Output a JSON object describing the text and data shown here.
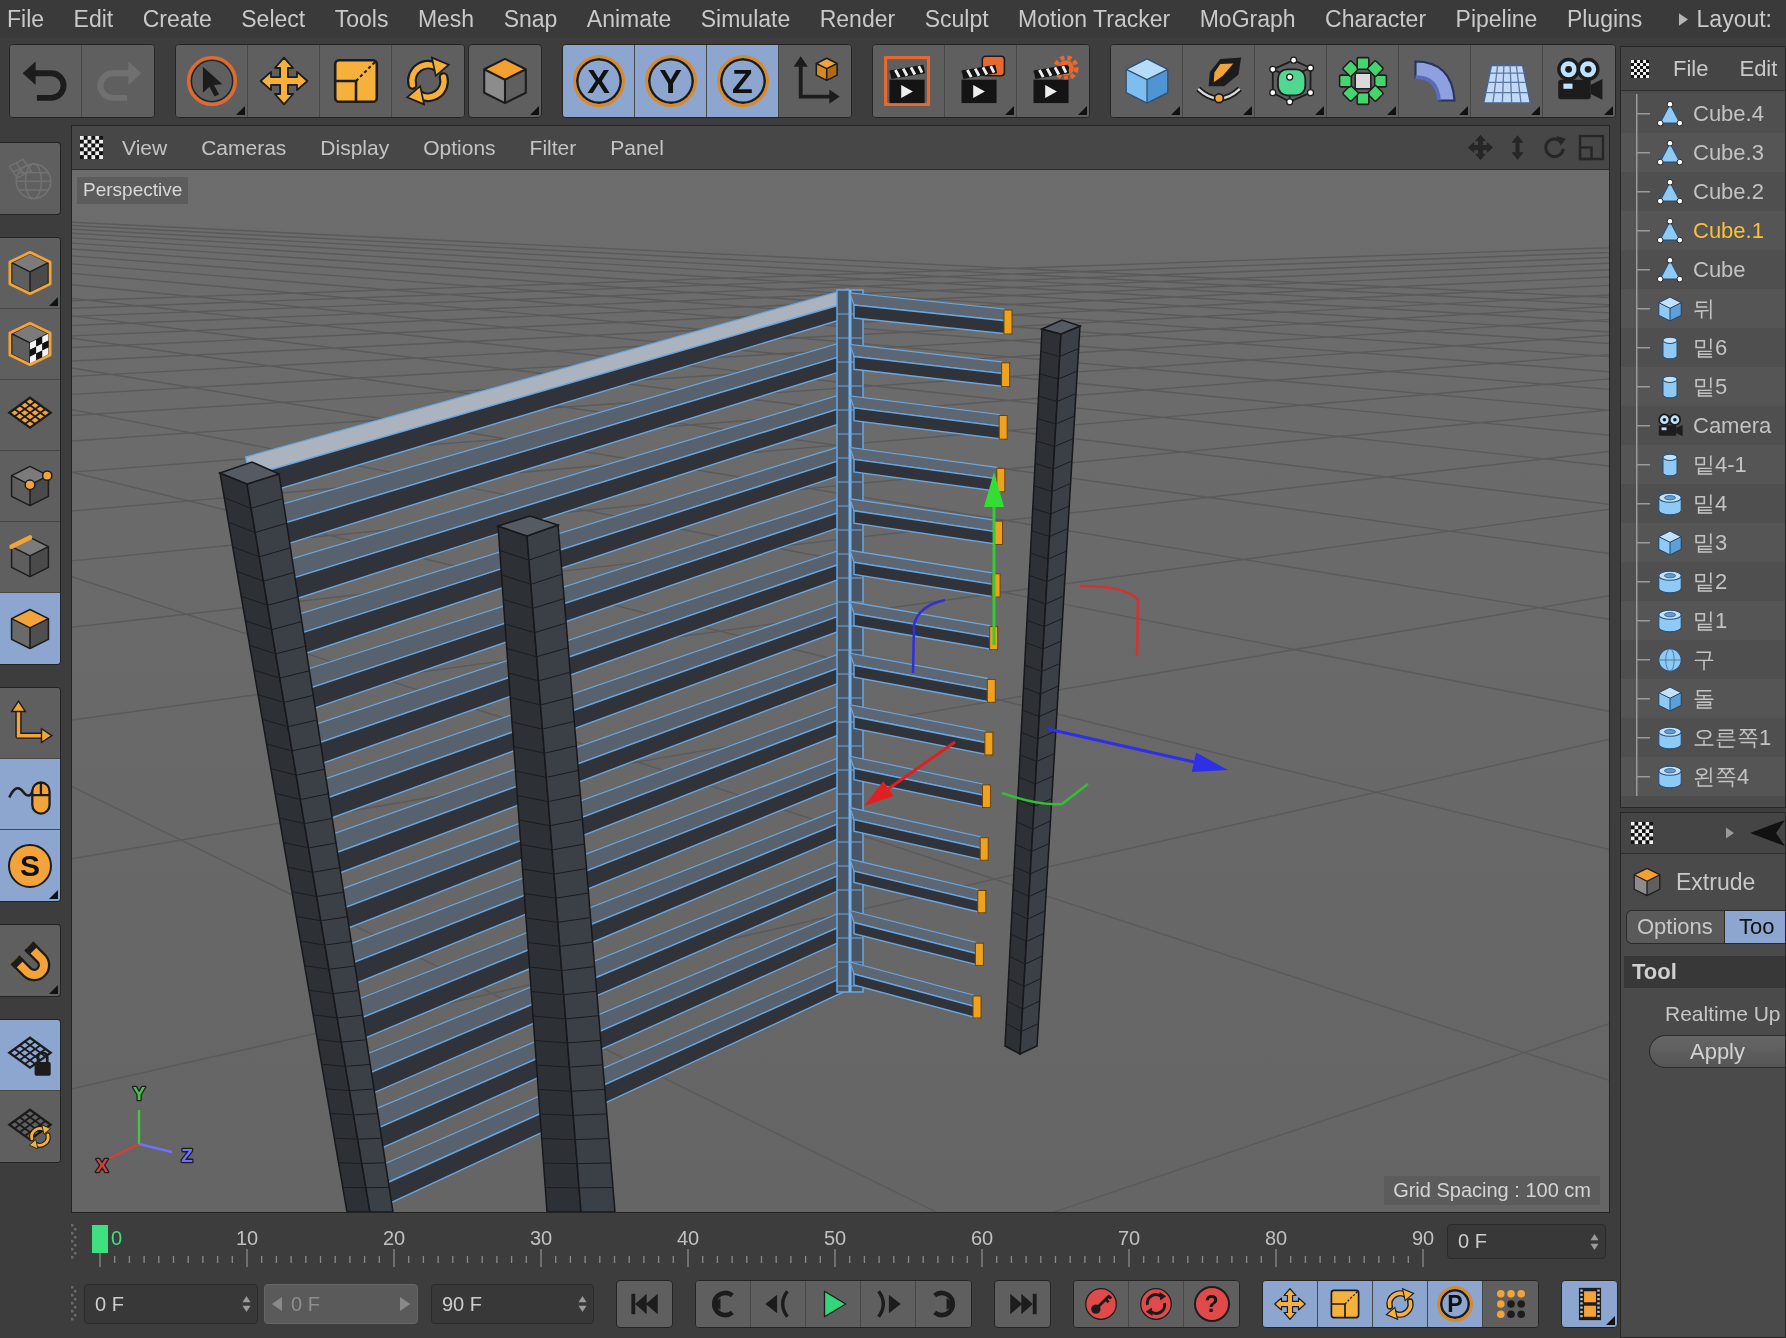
{
  "menubar": {
    "items": [
      "File",
      "Edit",
      "Create",
      "Select",
      "Tools",
      "Mesh",
      "Snap",
      "Animate",
      "Simulate",
      "Render",
      "Sculpt",
      "Motion Tracker",
      "MoGraph",
      "Character",
      "Pipeline",
      "Plugins"
    ],
    "layout_label": "Layout:"
  },
  "toolbar": {
    "groups": [
      [
        {
          "kind": "undo",
          "selected": false,
          "disabled": false,
          "submenu": false
        },
        {
          "kind": "redo",
          "selected": false,
          "disabled": true,
          "submenu": false
        }
      ],
      [
        {
          "kind": "select",
          "selected": false,
          "disabled": false,
          "submenu": true
        },
        {
          "kind": "move",
          "selected": false,
          "disabled": false,
          "submenu": false
        },
        {
          "kind": "scale",
          "selected": false,
          "disabled": false,
          "submenu": false
        },
        {
          "kind": "rotate",
          "selected": false,
          "disabled": false,
          "submenu": false
        }
      ],
      [
        {
          "kind": "extrude",
          "selected": false,
          "disabled": false,
          "submenu": true
        }
      ],
      [
        {
          "kind": "axis-lock",
          "label": "X",
          "selected": true,
          "disabled": false,
          "submenu": false
        },
        {
          "kind": "axis-lock",
          "label": "Y",
          "selected": true,
          "disabled": false,
          "submenu": false
        },
        {
          "kind": "axis-lock",
          "label": "Z",
          "selected": true,
          "disabled": false,
          "submenu": false
        },
        {
          "kind": "coordinate-system",
          "selected": false,
          "disabled": false,
          "submenu": false
        }
      ],
      [
        {
          "kind": "render-view",
          "selected": false,
          "disabled": false,
          "submenu": false
        },
        {
          "kind": "render-picture",
          "selected": false,
          "disabled": false,
          "submenu": true
        },
        {
          "kind": "render-settings",
          "selected": false,
          "disabled": false,
          "submenu": true
        }
      ],
      [
        {
          "kind": "cube",
          "selected": false,
          "disabled": false,
          "submenu": true
        },
        {
          "kind": "pen",
          "selected": false,
          "disabled": false,
          "submenu": true
        },
        {
          "kind": "subdivision",
          "selected": false,
          "disabled": false,
          "submenu": true
        },
        {
          "kind": "cloner",
          "selected": false,
          "disabled": false,
          "submenu": true
        },
        {
          "kind": "bend",
          "selected": false,
          "disabled": false,
          "submenu": true
        },
        {
          "kind": "floor",
          "selected": false,
          "disabled": false,
          "submenu": true
        },
        {
          "kind": "camera",
          "selected": false,
          "disabled": false,
          "submenu": true
        }
      ]
    ]
  },
  "tools": {
    "groups": [
      [
        {
          "kind": "globe",
          "selected": false,
          "disabled": true,
          "submenu": false
        }
      ],
      [
        {
          "kind": "model",
          "selected": false,
          "disabled": false,
          "submenu": true
        },
        {
          "kind": "texture",
          "selected": false,
          "disabled": false,
          "submenu": false
        },
        {
          "kind": "workplane",
          "selected": false,
          "disabled": false,
          "submenu": false
        },
        {
          "kind": "points",
          "selected": false,
          "disabled": false,
          "submenu": false
        },
        {
          "kind": "edges",
          "selected": false,
          "disabled": false,
          "submenu": false
        },
        {
          "kind": "polygons",
          "selected": true,
          "disabled": false,
          "submenu": false
        }
      ],
      [
        {
          "kind": "axis",
          "selected": false,
          "disabled": false,
          "submenu": false
        },
        {
          "kind": "tweak",
          "selected": true,
          "disabled": false,
          "submenu": false
        },
        {
          "kind": "snap",
          "label": "S",
          "selected": true,
          "disabled": false,
          "submenu": true
        }
      ],
      [
        {
          "kind": "magnet",
          "selected": false,
          "disabled": false,
          "submenu": true
        }
      ],
      [
        {
          "kind": "grid-lock",
          "selected": true,
          "disabled": false,
          "submenu": false
        },
        {
          "kind": "grid-sync",
          "selected": false,
          "disabled": false,
          "submenu": false
        }
      ]
    ]
  },
  "viewport": {
    "menu": [
      "View",
      "Cameras",
      "Display",
      "Options",
      "Filter",
      "Panel"
    ],
    "camera": "Perspective",
    "grid_spacing": "Grid Spacing : 100 cm",
    "axes": [
      {
        "label": "X",
        "color": "#d83c3c"
      },
      {
        "label": "Y",
        "color": "#44c844"
      },
      {
        "label": "Z",
        "color": "#7070ff"
      }
    ]
  },
  "timeline": {
    "labels": [
      {
        "text": "0",
        "current": true
      },
      {
        "text": "10",
        "current": false
      },
      {
        "text": "20",
        "current": false
      },
      {
        "text": "30",
        "current": false
      },
      {
        "text": "40",
        "current": false
      },
      {
        "text": "50",
        "current": false
      },
      {
        "text": "60",
        "current": false
      },
      {
        "text": "70",
        "current": false
      },
      {
        "text": "80",
        "current": false
      },
      {
        "text": "90",
        "current": false
      }
    ],
    "playhead": {
      "level": 0
    },
    "frame_field": "0 F"
  },
  "playback": {
    "start_field": "0 F",
    "range_field": {
      "value": "0 F",
      "disabled": true
    },
    "end_field": "90 F",
    "groups": [
      [
        {
          "kind": "go-start",
          "selected": false,
          "submenu": false
        }
      ],
      [
        {
          "kind": "prev-key",
          "selected": false,
          "submenu": false
        },
        {
          "kind": "prev-frame",
          "selected": false,
          "submenu": false
        },
        {
          "kind": "play",
          "selected": false,
          "submenu": false
        },
        {
          "kind": "next-frame",
          "selected": false,
          "submenu": false
        },
        {
          "kind": "next-key",
          "selected": false,
          "submenu": false
        }
      ],
      [
        {
          "kind": "go-end",
          "selected": false,
          "submenu": false
        }
      ],
      [
        {
          "kind": "record",
          "selected": false,
          "submenu": false
        },
        {
          "kind": "autokey",
          "selected": false,
          "submenu": false
        },
        {
          "kind": "key-help",
          "label": "?",
          "selected": false,
          "submenu": false
        }
      ],
      [
        {
          "kind": "key-position",
          "selected": true,
          "submenu": false
        },
        {
          "kind": "key-scale",
          "selected": true,
          "submenu": false
        },
        {
          "kind": "key-rotation",
          "selected": true,
          "submenu": false
        },
        {
          "kind": "key-parameter",
          "label": "P",
          "selected": true,
          "submenu": false
        },
        {
          "kind": "key-pla",
          "selected": false,
          "submenu": false
        }
      ],
      [
        {
          "kind": "timeline",
          "selected": true,
          "submenu": true
        }
      ]
    ]
  },
  "objects": {
    "menu": [
      "File",
      "Edit"
    ],
    "items": [
      {
        "name": "Cube.4",
        "kind": "polygon",
        "selected": false
      },
      {
        "name": "Cube.3",
        "kind": "polygon",
        "selected": false
      },
      {
        "name": "Cube.2",
        "kind": "polygon",
        "selected": false
      },
      {
        "name": "Cube.1",
        "kind": "polygon",
        "selected": true
      },
      {
        "name": "Cube",
        "kind": "polygon",
        "selected": false
      },
      {
        "name": "뒤",
        "kind": "cube",
        "selected": false
      },
      {
        "name": "밑6",
        "kind": "cylinder",
        "selected": false
      },
      {
        "name": "밑5",
        "kind": "cylinder",
        "selected": false
      },
      {
        "name": "Camera",
        "kind": "camera",
        "selected": false
      },
      {
        "name": "밑4-1",
        "kind": "cylinder",
        "selected": false
      },
      {
        "name": "밑4",
        "kind": "tube",
        "selected": false
      },
      {
        "name": "밑3",
        "kind": "cube",
        "selected": false
      },
      {
        "name": "밑2",
        "kind": "tube",
        "selected": false
      },
      {
        "name": "밑1",
        "kind": "tube",
        "selected": false
      },
      {
        "name": "구",
        "kind": "sphere",
        "selected": false
      },
      {
        "name": "돌",
        "kind": "cube",
        "selected": false
      },
      {
        "name": "오른쪽1",
        "kind": "tube",
        "selected": false
      },
      {
        "name": "왼쪽4",
        "kind": "tube",
        "selected": false
      }
    ]
  },
  "attributes": {
    "title": "Extrude",
    "tabs": [
      {
        "label": "Options",
        "selected": false
      },
      {
        "label": "Too",
        "selected": true
      }
    ],
    "section": "Tool",
    "option_label": "Realtime Up",
    "button": "Apply"
  }
}
